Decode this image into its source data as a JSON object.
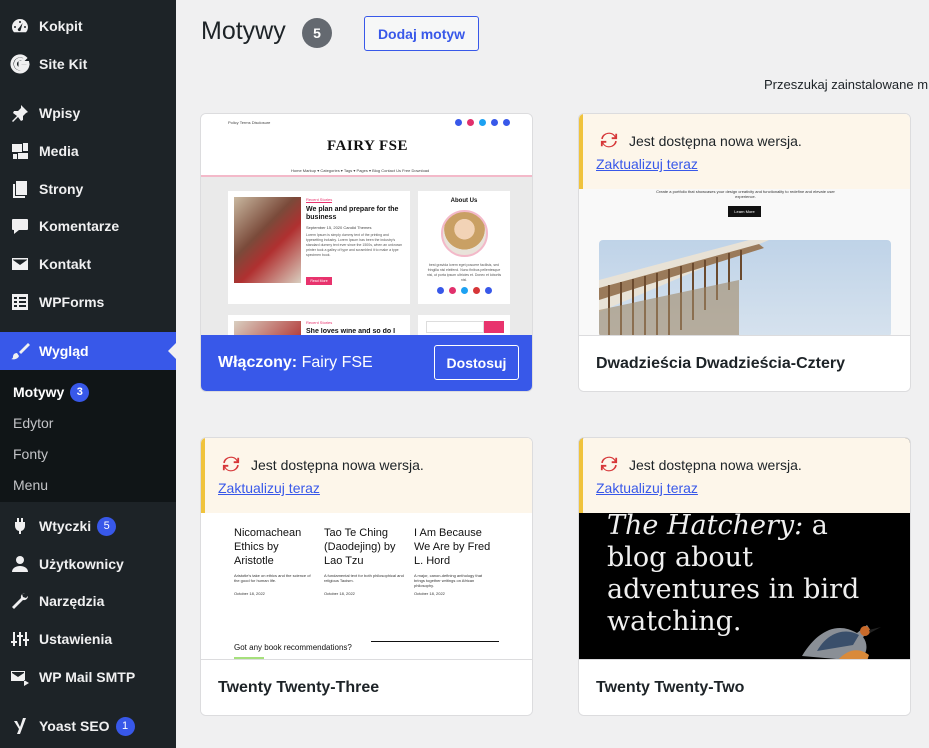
{
  "sidebar": {
    "items": [
      {
        "label": "Kokpit",
        "icon": "dashboard-icon"
      },
      {
        "label": "Site Kit",
        "icon": "google-g-icon"
      },
      {
        "label": "Wpisy",
        "icon": "pushpin-icon"
      },
      {
        "label": "Media",
        "icon": "media-icon"
      },
      {
        "label": "Strony",
        "icon": "pages-icon"
      },
      {
        "label": "Komentarze",
        "icon": "comment-icon"
      },
      {
        "label": "Kontakt",
        "icon": "envelope-icon"
      },
      {
        "label": "WPForms",
        "icon": "forms-icon"
      },
      {
        "label": "Wygląd",
        "icon": "paintbrush-icon"
      },
      {
        "label": "Wtyczki",
        "icon": "plugin-icon",
        "badge": "5"
      },
      {
        "label": "Użytkownicy",
        "icon": "user-icon"
      },
      {
        "label": "Narzędzia",
        "icon": "wrench-icon"
      },
      {
        "label": "Ustawienia",
        "icon": "settings-sliders-icon"
      },
      {
        "label": "WP Mail SMTP",
        "icon": "mail-send-icon"
      },
      {
        "label": "Yoast SEO",
        "icon": "yoast-icon",
        "badge": "1"
      }
    ],
    "submenu": [
      {
        "label": "Motywy",
        "badge": "3"
      },
      {
        "label": "Edytor"
      },
      {
        "label": "Fonty"
      },
      {
        "label": "Menu"
      }
    ]
  },
  "header": {
    "title": "Motywy",
    "count": "5",
    "add_button": "Dodaj motyw",
    "search_label": "Przeszukaj zainstalowane m"
  },
  "themes": [
    {
      "active_label": "Włączony:",
      "name": "Fairy FSE",
      "customize": "Dostosuj",
      "shot": {
        "nav_small": "Policy  Terms  Disclosure",
        "logo": "FAIRY FSE",
        "menu": "Home   Markup ▾   Categories ▾   Tags ▾   Pages ▾   Blog   Contact Us   Free Download",
        "tag": "Recent Stories",
        "post_title": "We plan and prepare for the business",
        "post_meta": "September 15, 2020    Candid Themes",
        "post_excerpt": "Lorem Ipsum is simply dummy text of the printing and typesetting industry. Lorem Ipsum has been the industry's standard dummy text ever since the 1500s, when an unknown printer took a galley of type and scrambled it to make a type specimen book.",
        "read_more": "Read More",
        "about_title": "About Us",
        "about_text": "best gravida lorem eget posuere facilisis, sed fringilla nisl eleifend. Nunc finibus pellentesque nisi, ut porta ipsum ultricies et. Donec et lobortis nisl.",
        "post2_title": "She loves wine and so do I"
      }
    },
    {
      "name": "Dwadzieścia Dwadzieścia-Cztery",
      "notice": "Jest dostępna nowa wersja.",
      "update_link": "Zaktualizuj teraz",
      "shot": {
        "intro": "Create a portfolio that showcases your design creativity and functionality to redefine and elevate user experience.",
        "button": "Learn More"
      }
    },
    {
      "name": "Twenty Twenty-Three",
      "notice": "Jest dostępna nowa wersja.",
      "update_link": "Zaktualizuj teraz",
      "shot": {
        "books": [
          {
            "title": "Nicomachean Ethics by Aristotle",
            "desc": "Aristotle's take on ethics and the science of the good for human life.",
            "date": "October 18, 2022"
          },
          {
            "title": "Tao Te Ching (Daodejing) by Lao Tzu",
            "desc": "A fundamental text for both philosophical and religious Taoism.",
            "date": "October 18, 2022"
          },
          {
            "title": "I Am Because We Are by Fred L. Hord",
            "desc": "A major, canon-defining anthology that brings together writings on African philosophy.",
            "date": "October 18, 2022"
          }
        ],
        "footer_q": "Got any book recommendations?"
      }
    },
    {
      "name": "Twenty Twenty-Two",
      "notice": "Jest dostępna nowa wersja.",
      "update_link": "Zaktualizuj teraz",
      "shot": {
        "headline_em": "The Hatchery:",
        "headline_rest": " a blog about adventures in bird watching."
      }
    }
  ],
  "colors": {
    "sidebar_bg": "#1d2327",
    "accent": "#3858e9",
    "notice_border": "#f0c33c",
    "update_icon": "#d63638"
  }
}
